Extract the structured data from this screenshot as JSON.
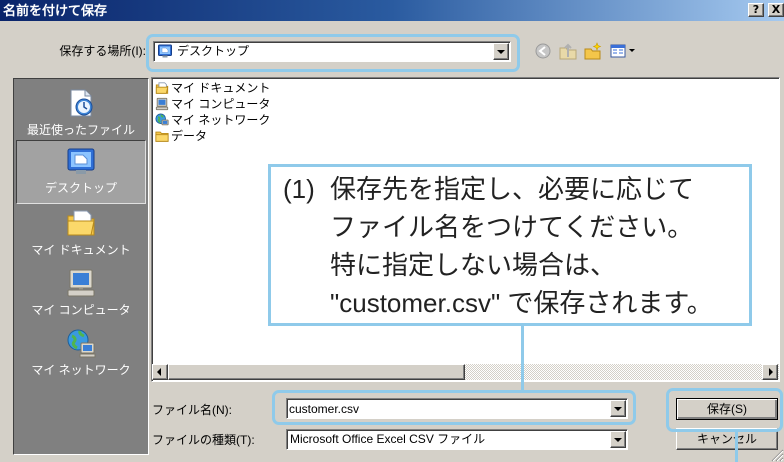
{
  "window": {
    "title": "名前を付けて保存",
    "help_button": "?",
    "close_button": "X"
  },
  "location": {
    "label": "保存する場所(I):",
    "value": "デスクトップ",
    "icon": "desktop-icon"
  },
  "toolbar": {
    "icons": [
      "back-icon",
      "up-folder-icon",
      "new-folder-icon",
      "view-menu-icon"
    ]
  },
  "places": [
    {
      "label": "最近使ったファイル",
      "icon": "recent-files-icon",
      "selected": false
    },
    {
      "label": "デスクトップ",
      "icon": "desktop-icon",
      "selected": true
    },
    {
      "label": "マイ ドキュメント",
      "icon": "my-documents-icon",
      "selected": false
    },
    {
      "label": "マイ コンピュータ",
      "icon": "my-computer-icon",
      "selected": false
    },
    {
      "label": "マイ ネットワーク",
      "icon": "my-network-icon",
      "selected": false
    }
  ],
  "files": [
    {
      "name": "マイ ドキュメント",
      "icon": "my-documents-icon"
    },
    {
      "name": "マイ コンピュータ",
      "icon": "my-computer-icon"
    },
    {
      "name": "マイ ネットワーク",
      "icon": "my-network-icon"
    },
    {
      "name": "データ",
      "icon": "folder-icon"
    }
  ],
  "callout": {
    "marker": "(1)",
    "lines": [
      "保存先を指定し、必要に応じて",
      "ファイル名をつけてください。",
      "特に指定しない場合は、",
      "\"customer.csv\" で保存されます。"
    ]
  },
  "filename": {
    "label": "ファイル名(N):",
    "value": "customer.csv"
  },
  "filetype": {
    "label": "ファイルの種類(T):",
    "value": "Microsoft Office Excel CSV ファイル"
  },
  "buttons": {
    "save": "保存(S)",
    "cancel": "キャンセル"
  },
  "colors": {
    "title_bar_start": "#0a246a",
    "title_bar_end": "#a6caf0",
    "dialog_bg": "#d4d0c8",
    "places_bg": "#808080",
    "annotation_highlight": "#8fcaea"
  }
}
